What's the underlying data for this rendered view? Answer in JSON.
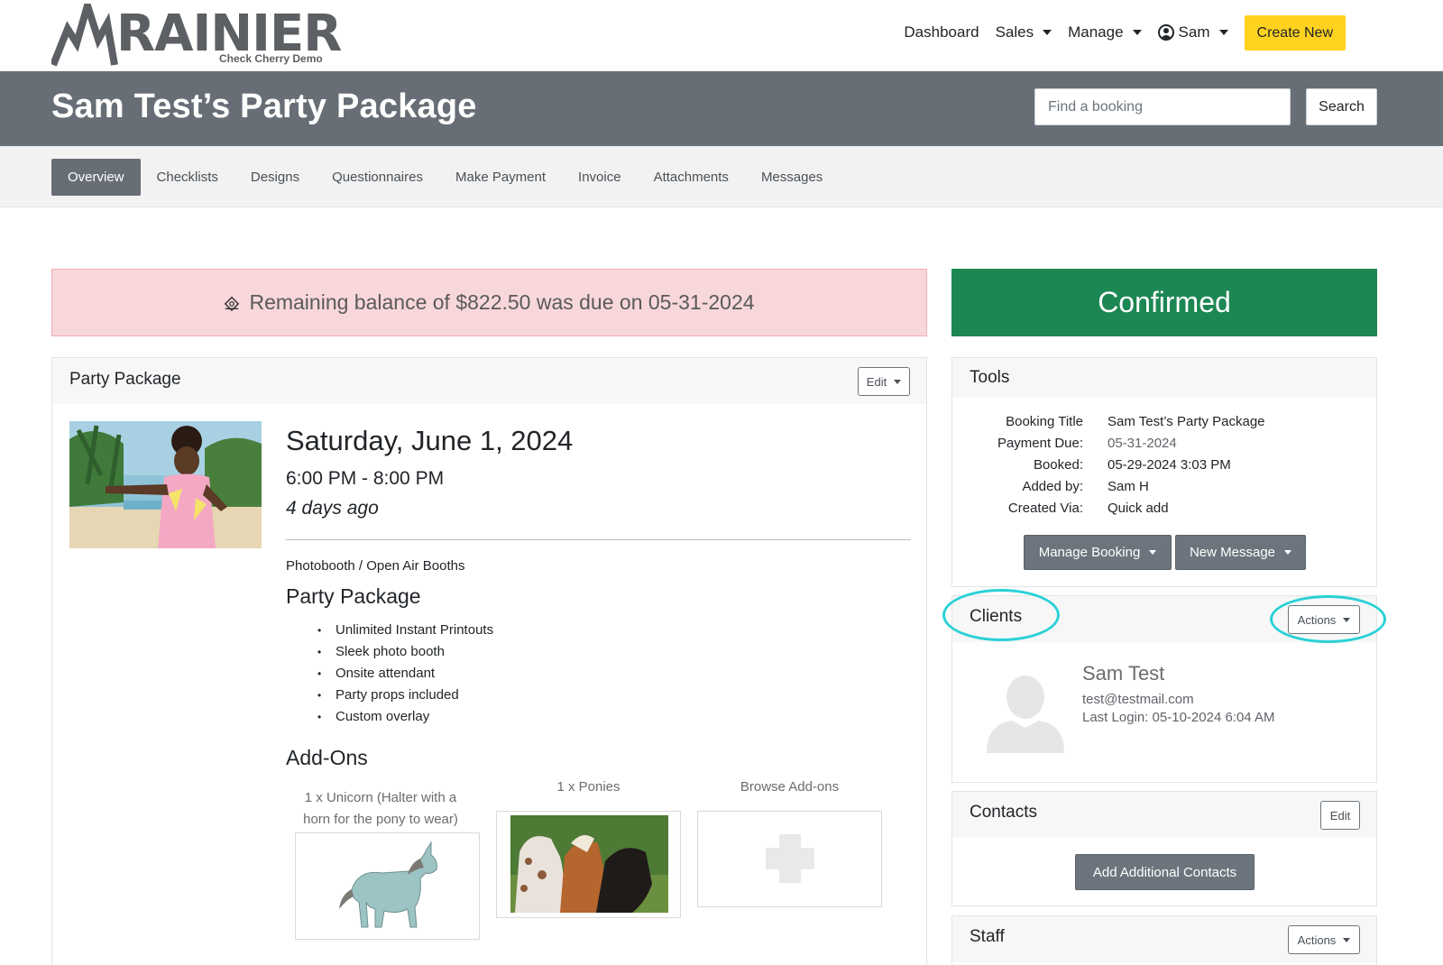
{
  "brand": {
    "name": "RAINIER",
    "subtitle": "Check Cherry Demo"
  },
  "nav": {
    "dashboard": "Dashboard",
    "sales": "Sales",
    "manage": "Manage",
    "user": "Sam",
    "create_new": "Create New"
  },
  "header": {
    "title": "Sam Test’s Party Package",
    "search_placeholder": "Find a booking",
    "search_button": "Search"
  },
  "tabs": [
    {
      "label": "Overview",
      "active": true
    },
    {
      "label": "Checklists"
    },
    {
      "label": "Designs"
    },
    {
      "label": "Questionnaires"
    },
    {
      "label": "Make Payment"
    },
    {
      "label": "Invoice"
    },
    {
      "label": "Attachments"
    },
    {
      "label": "Messages"
    }
  ],
  "alert": {
    "text": "Remaining balance of $822.50 was due on 05-31-2024"
  },
  "status": {
    "label": "Confirmed",
    "color": "#1c8753"
  },
  "package_card": {
    "title": "Party Package",
    "edit_button": "Edit",
    "event_date": "Saturday, June 1, 2024",
    "event_time": "6:00 PM - 8:00 PM",
    "relative": "4 days ago",
    "category": "Photobooth / Open Air Booths",
    "package_name": "Party Package",
    "features": [
      "Unlimited Instant Printouts",
      "Sleek photo booth",
      "Onsite attendant",
      "Party props included",
      "Custom overlay"
    ],
    "addons_title": "Add-Ons",
    "addons": [
      {
        "label_line1": "1 x Unicorn (Halter with a",
        "label_line2": "horn for the pony to wear)"
      },
      {
        "label_line1": "1 x Ponies"
      },
      {
        "label_line1": "Browse Add-ons"
      }
    ]
  },
  "tools": {
    "title": "Tools",
    "rows": [
      {
        "key": "Booking Title",
        "value": "Sam Test’s Party Package"
      },
      {
        "key": "Payment Due:",
        "value": "05-31-2024"
      },
      {
        "key": "Booked:",
        "value": "05-29-2024 3:03 PM"
      },
      {
        "key": "Added by:",
        "value": "Sam H"
      },
      {
        "key": "Created Via:",
        "value": "Quick add"
      }
    ],
    "manage_booking": "Manage Booking",
    "new_message": "New Message"
  },
  "clients": {
    "title": "Clients",
    "actions": "Actions",
    "client": {
      "name": "Sam Test",
      "email": "test@testmail.com",
      "last_login": "Last Login: 05-10-2024 6:04 AM"
    }
  },
  "contacts": {
    "title": "Contacts",
    "edit": "Edit",
    "add_button": "Add Additional Contacts"
  },
  "staff": {
    "title": "Staff",
    "actions": "Actions"
  },
  "colors": {
    "header_band": "#686e76",
    "accent_yellow": "#ffd21f",
    "alert_bg": "#f8d7da",
    "confirmed_green": "#1c8753",
    "highlight": "#2ad1d6"
  }
}
